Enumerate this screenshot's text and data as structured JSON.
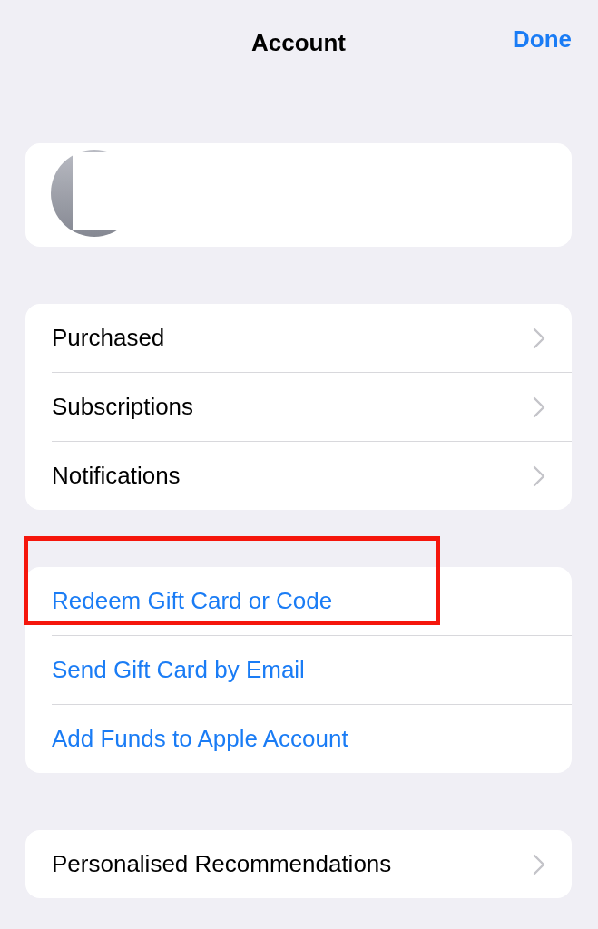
{
  "header": {
    "title": "Account",
    "done": "Done"
  },
  "sections": [
    {
      "rows": [
        {
          "label": "Purchased",
          "kind": "nav",
          "highlighted": false
        },
        {
          "label": "Subscriptions",
          "kind": "nav",
          "highlighted": false
        },
        {
          "label": "Notifications",
          "kind": "nav",
          "highlighted": false
        }
      ]
    },
    {
      "rows": [
        {
          "label": "Redeem Gift Card or Code",
          "kind": "action",
          "highlighted": true
        },
        {
          "label": "Send Gift Card by Email",
          "kind": "action",
          "highlighted": false
        },
        {
          "label": "Add Funds to Apple Account",
          "kind": "action",
          "highlighted": false
        }
      ]
    },
    {
      "rows": [
        {
          "label": "Personalised Recommendations",
          "kind": "nav",
          "highlighted": false
        }
      ]
    }
  ]
}
